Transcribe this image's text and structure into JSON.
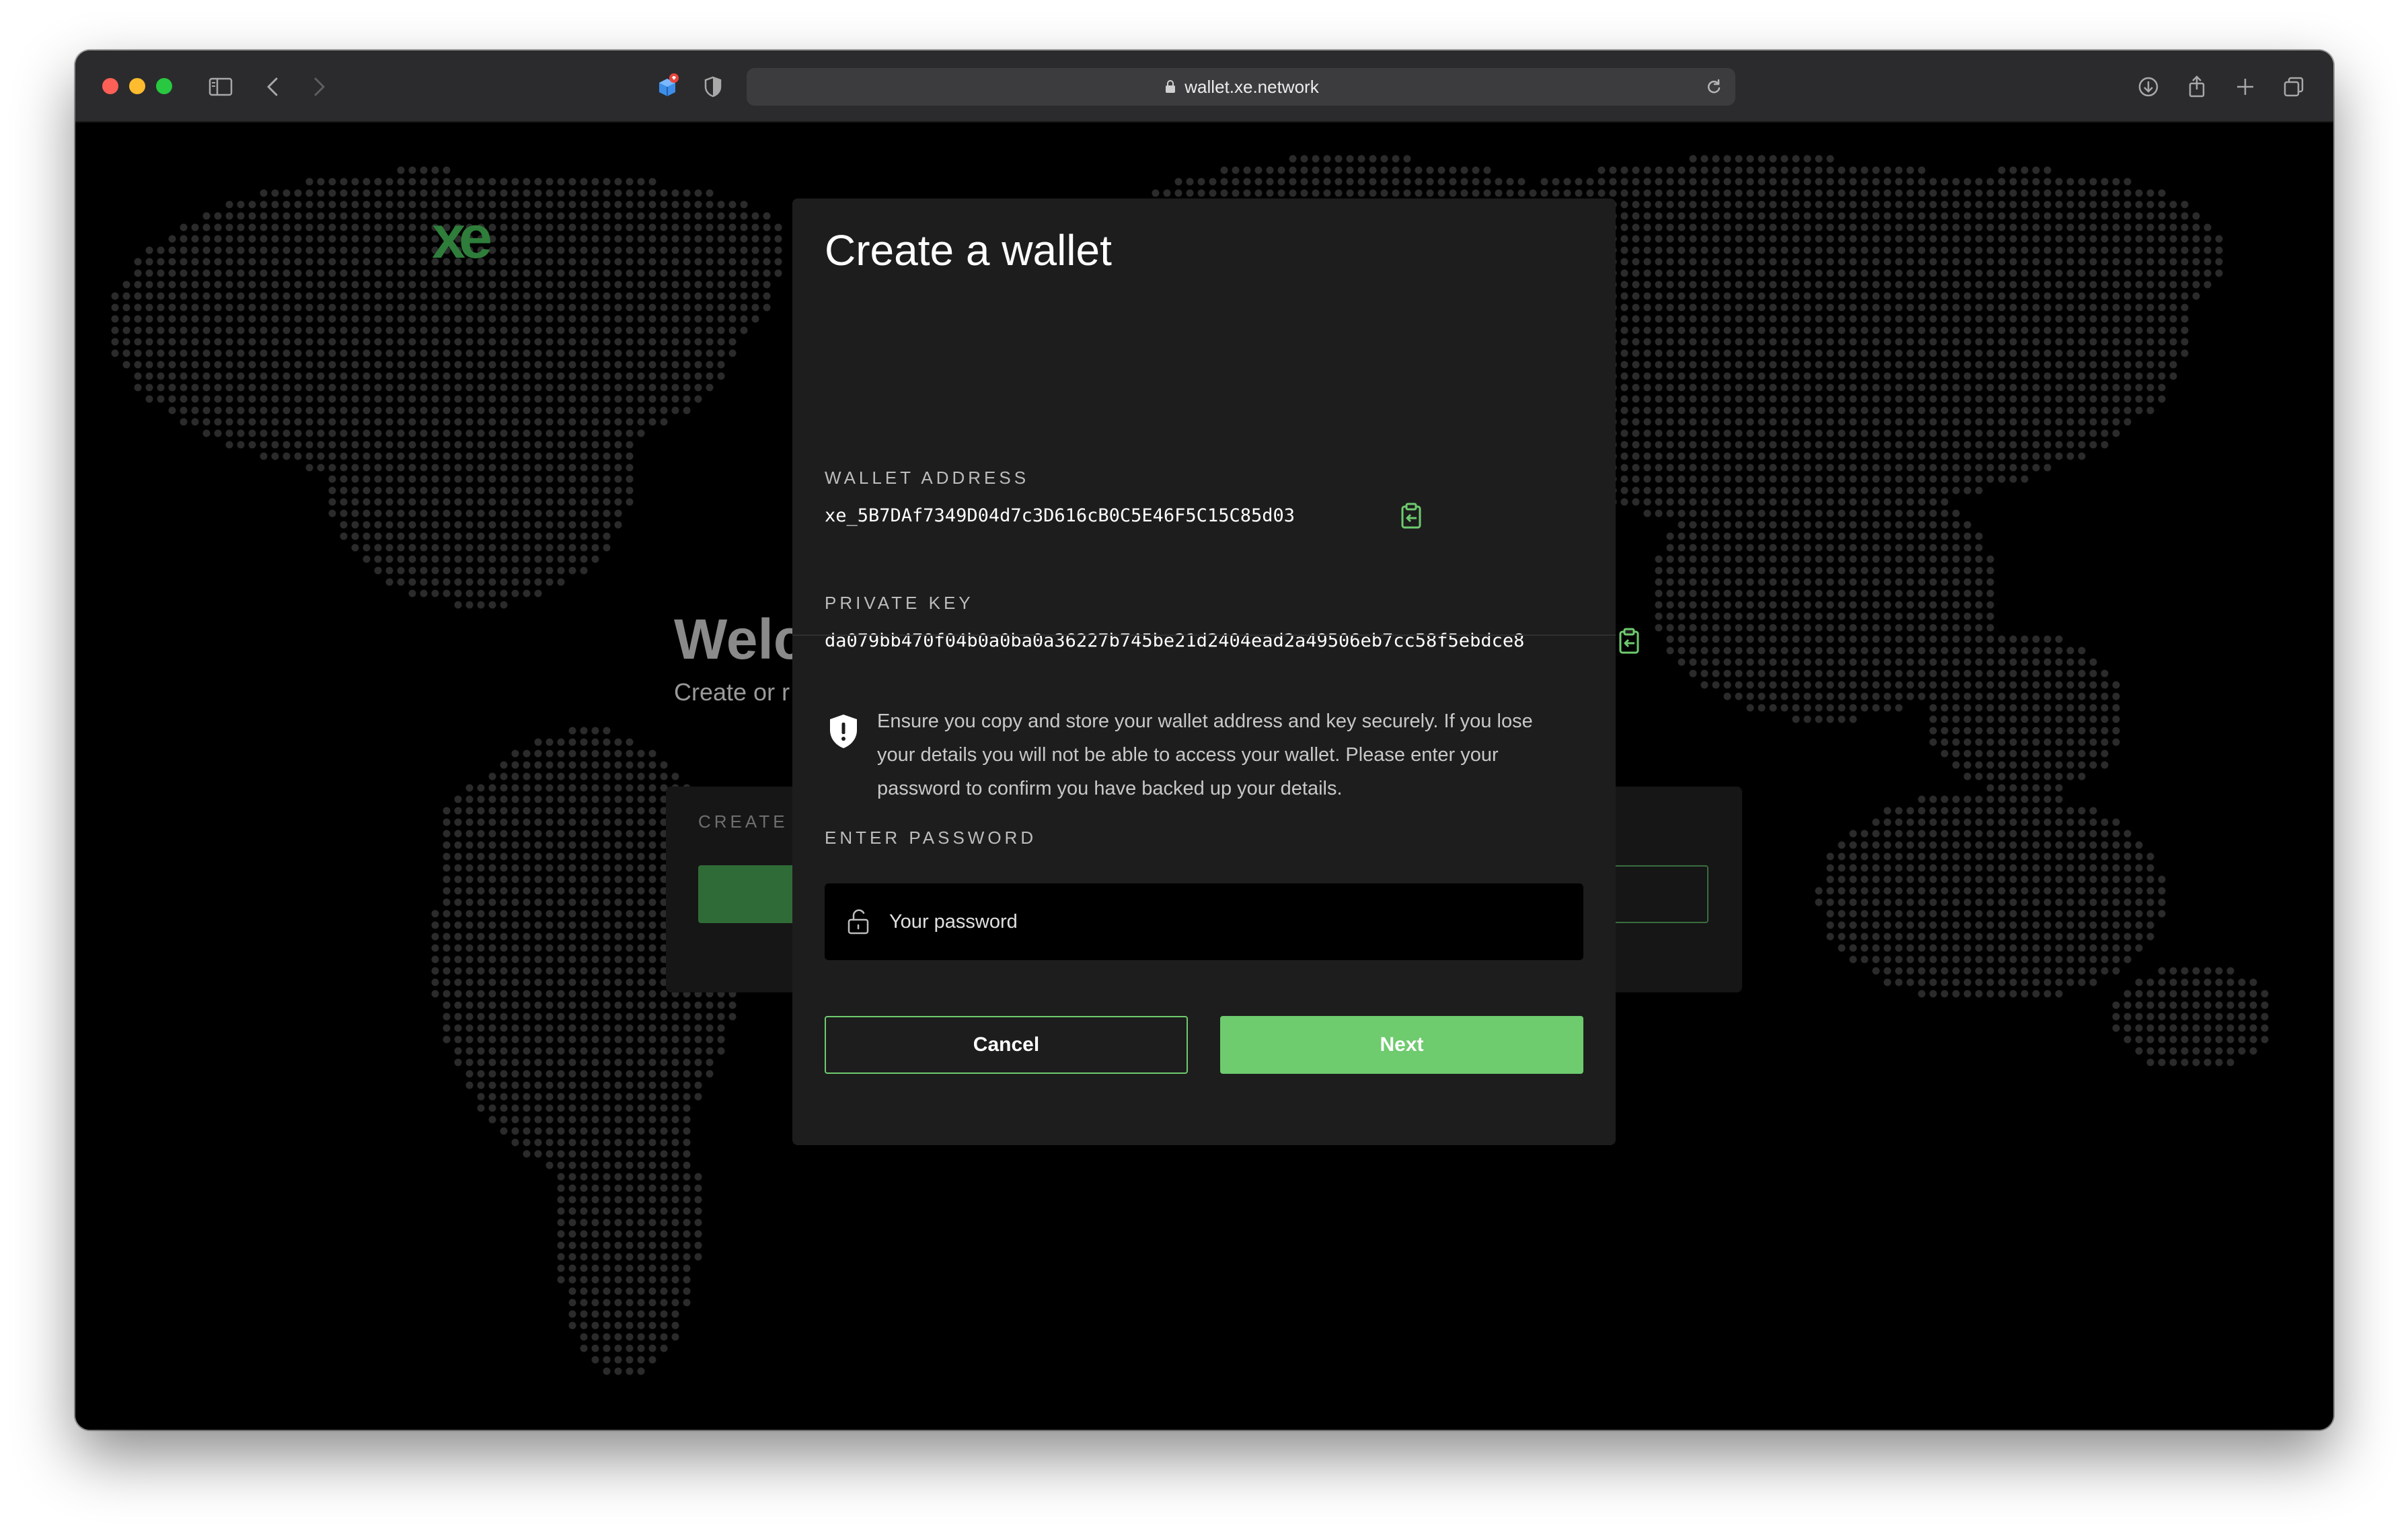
{
  "browser": {
    "url": "wallet.xe.network",
    "icons": [
      "sidebar-icon",
      "back-icon",
      "forward-icon",
      "extension-icon",
      "shield-icon",
      "lock-icon",
      "reload-icon",
      "download-icon",
      "share-icon",
      "new-tab-icon",
      "tabs-overview-icon"
    ]
  },
  "background": {
    "logo": "xe",
    "title": "Welc",
    "subtitle": "Create or r",
    "panel_label": "CREATE A"
  },
  "modal": {
    "title": "Create a wallet",
    "wallet_address_label": "WALLET ADDRESS",
    "wallet_address": "xe_5B7DAf7349D04d7c3D616cB0C5E46F5C15C85d03",
    "private_key_label": "PRIVATE KEY",
    "private_key": "da079bb470f04b0a0ba0a36227b745be21d2404ead2a49506eb7cc58f5ebdce8",
    "notice": "Ensure you copy and store your wallet address and key securely. If you lose your details you will not be able to access your wallet. Please enter your password to confirm you have backed up your details.",
    "password_label": "ENTER PASSWORD",
    "password_placeholder": "Your password",
    "cancel_label": "Cancel",
    "next_label": "Next"
  },
  "colors": {
    "accent": "#6ecb6e",
    "modal_bg": "#1d1d1d",
    "page_bg": "#000000",
    "map_dot": "#2b2b2b"
  }
}
